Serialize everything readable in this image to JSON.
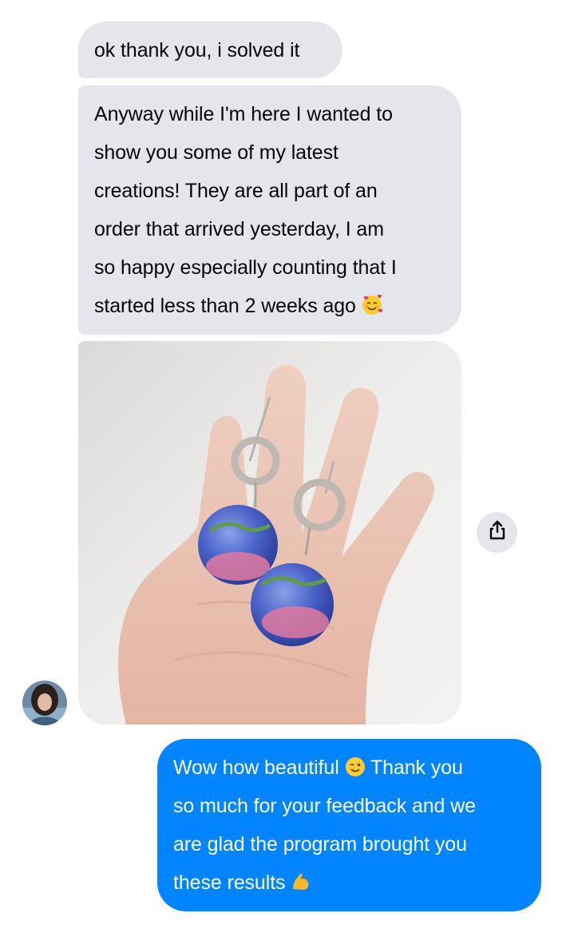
{
  "conversation": {
    "messages": [
      {
        "sender": "contact",
        "text": "ok thank you, i solved it"
      },
      {
        "sender": "contact",
        "lines": [
          "Anyway while I'm here I wanted to",
          "show you some of my latest",
          "creations! They are all part of an",
          "order that arrived yesterday, I am",
          "so happy especially counting that I",
          "started less than 2 weeks ago"
        ],
        "trailing_emoji": "smiling-face-with-hearts-emoji"
      },
      {
        "sender": "contact",
        "type": "photo",
        "content": "hand holding earrings photo"
      },
      {
        "sender": "me",
        "parts": [
          "Wow how beautiful",
          "Thank you",
          "so much for your feedback and we",
          "are glad the program brought you",
          "these results"
        ],
        "emojis": [
          "winking-face-emoji",
          "flexed-biceps-emoji"
        ]
      }
    ],
    "share_icon": "share-icon",
    "avatar_icon": "avatar"
  },
  "colors": {
    "incoming_bubble": "#e4e6eb",
    "outgoing_bubble": "#0084ff",
    "outgoing_text": "#ffffff",
    "incoming_text": "#050505"
  }
}
